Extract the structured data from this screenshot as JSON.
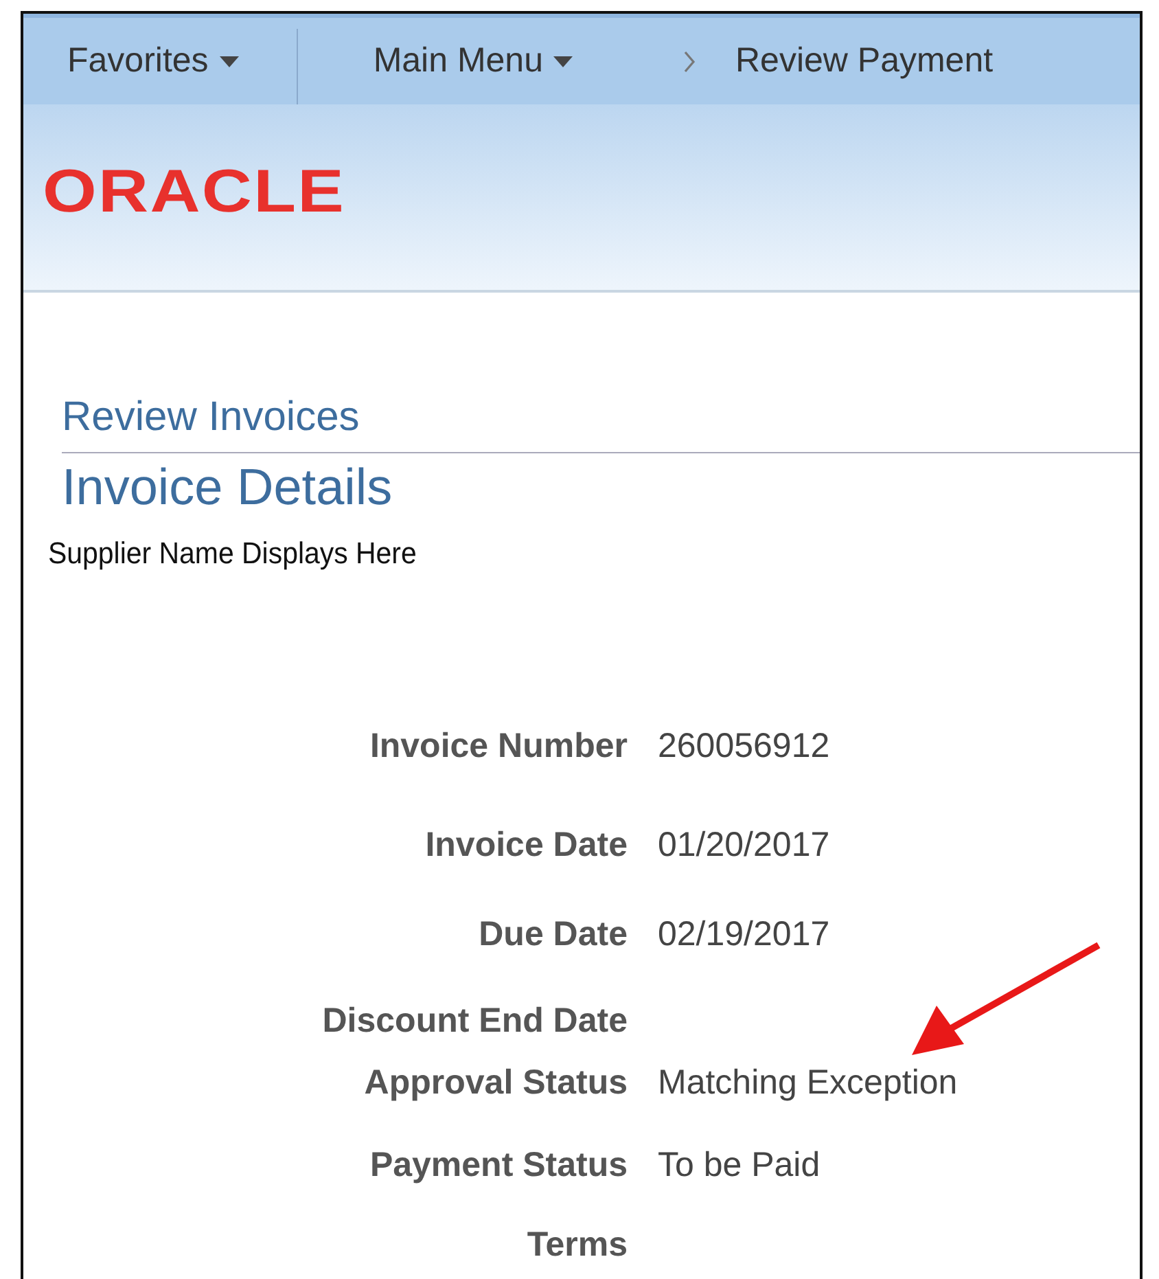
{
  "nav_bar": {
    "items": [
      {
        "kind": "menu",
        "label": "Favorites"
      },
      {
        "kind": "menu",
        "label": "Main Menu"
      },
      {
        "kind": "crumb",
        "label": "Review Payment"
      }
    ]
  },
  "banner": {
    "logo": "ORACLE"
  },
  "breadcrumb": "Review Invoices",
  "page_title": "Invoice Details",
  "supplier": "Supplier Name Displays Here",
  "fields": [
    {
      "label": "Invoice Number",
      "value": "260056912"
    },
    {
      "label": "Invoice Date",
      "value": "01/20/2017"
    },
    {
      "label": "Due Date",
      "value": "02/19/2017"
    },
    {
      "label": "Discount End Date"
    },
    {
      "label": "Approval Status",
      "value": "Matching Exception"
    },
    {
      "label": "Payment Status",
      "value": "To be Paid"
    },
    {
      "label": "Terms"
    }
  ]
}
